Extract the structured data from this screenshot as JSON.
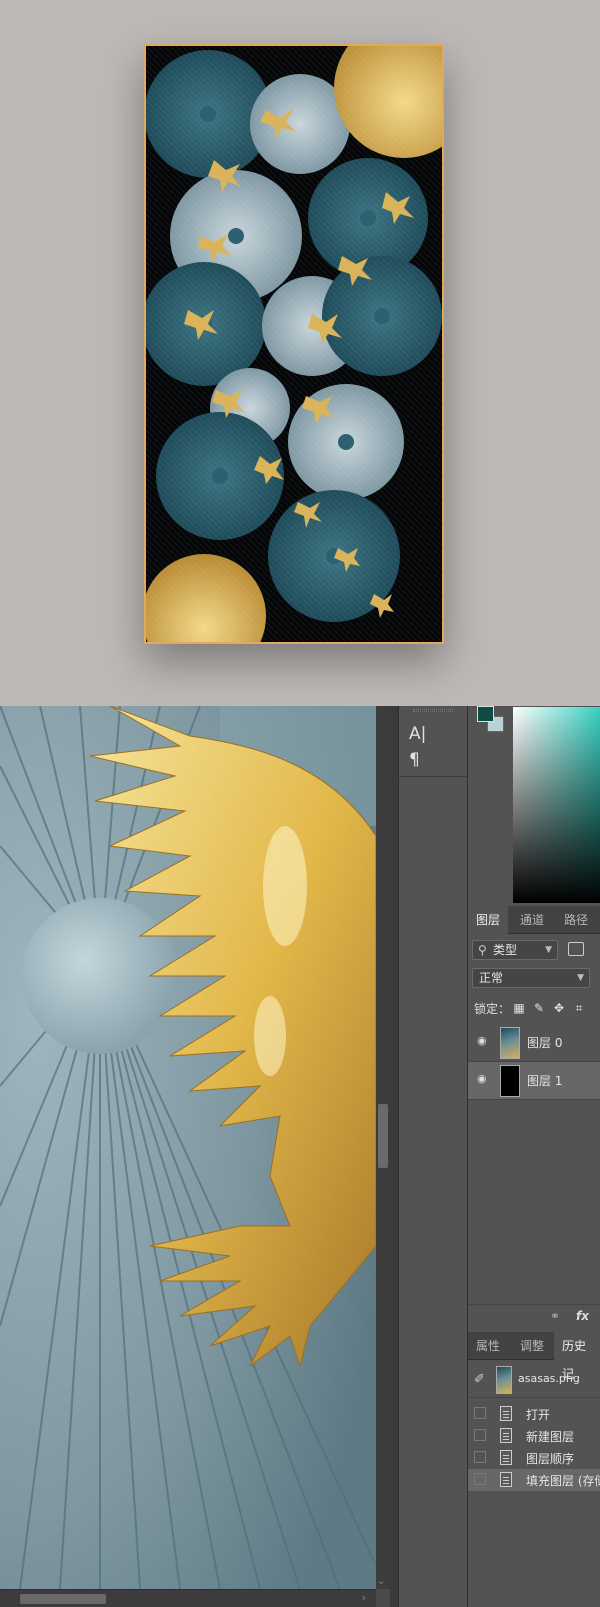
{
  "layers_panel": {
    "tabs": [
      "图层",
      "通道",
      "路径"
    ],
    "filter_kind": "类型",
    "blend_mode": "正常",
    "lock_label": "锁定：",
    "layers": [
      {
        "name": "图层 0",
        "visible": true
      },
      {
        "name": "图层 1",
        "visible": true
      }
    ],
    "footer_icons": [
      "link-icon",
      "fx-icon"
    ],
    "fx_label": "fx"
  },
  "history_panel": {
    "tabs": [
      "属性",
      "调整",
      "历史记"
    ],
    "snapshot_name": "asasas.png",
    "items": [
      "打开",
      "新建图层",
      "图层顺序",
      "填充图层 (存储"
    ]
  },
  "colors": {
    "foreground": "#0f4a46",
    "background": "#b8d2d8",
    "frame_border": "#e3a85a",
    "gold": "#d9b45a"
  },
  "tools": [
    "type-tool-icon",
    "paragraph-icon"
  ]
}
